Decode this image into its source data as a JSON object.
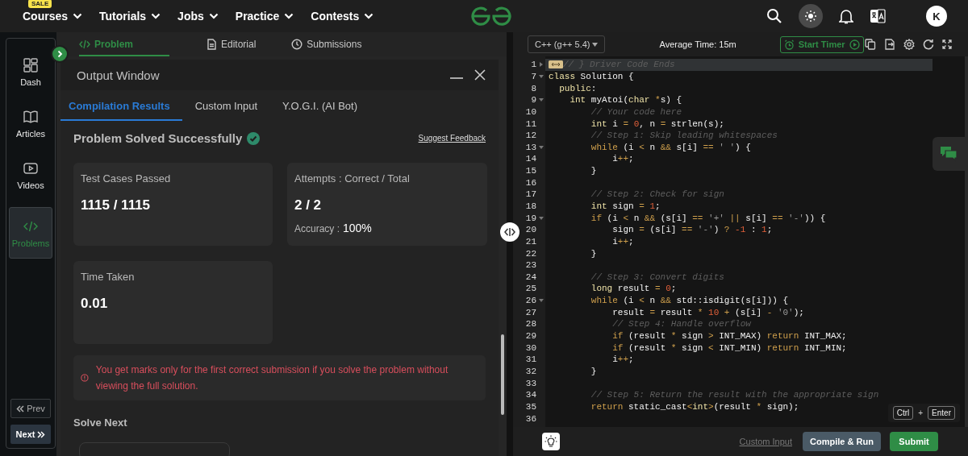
{
  "nav": {
    "items": [
      {
        "label": "Courses",
        "badge": "SALE"
      },
      {
        "label": "Tutorials"
      },
      {
        "label": "Jobs"
      },
      {
        "label": "Practice"
      },
      {
        "label": "Contests"
      }
    ],
    "avatar": "K"
  },
  "sidebar": {
    "items": [
      {
        "label": "Dash",
        "kind": "dash",
        "selected": false
      },
      {
        "label": "Articles",
        "kind": "articles",
        "selected": false
      },
      {
        "label": "Videos",
        "kind": "videos",
        "selected": false
      },
      {
        "label": "Problems",
        "kind": "problems",
        "selected": true
      }
    ],
    "prev": "Prev",
    "next": "Next"
  },
  "problem_tabs": [
    {
      "label": "Problem",
      "kind": "code",
      "selected": true
    },
    {
      "label": "Editorial",
      "kind": "doc",
      "selected": false
    },
    {
      "label": "Submissions",
      "kind": "clock",
      "selected": false
    }
  ],
  "output_window": {
    "title": "Output Window",
    "tabs": [
      {
        "label": "Compilation Results",
        "selected": true
      },
      {
        "label": "Custom Input",
        "selected": false
      },
      {
        "label": "Y.O.G.I. (AI Bot)",
        "selected": false
      }
    ],
    "status": "Problem Solved Successfully",
    "feedback_link": "Suggest Feedback",
    "cards": [
      {
        "label": "Test Cases Passed",
        "value": "1115 / 1115"
      },
      {
        "label": "Attempts : Correct / Total",
        "value": "2 / 2",
        "accuracy_label": "Accuracy :",
        "accuracy": "100%"
      },
      {
        "label": "Time Taken",
        "value": "0.01"
      }
    ],
    "warning": "You get marks only for the first correct submission if you solve the problem without viewing the full solution.",
    "solve_next": "Solve Next"
  },
  "editor": {
    "language": "C++ (g++ 5.4)",
    "average_time": "Average Time: 15m",
    "timer_button": "Start Timer",
    "lines": [
      {
        "n": "1",
        "foldable": true,
        "folded": true,
        "highlighted": true,
        "tokens": [
          {
            "kind": "comment",
            "text": "// } Driver Code Ends"
          }
        ]
      },
      {
        "n": "7",
        "foldable": true,
        "folded": false,
        "highlighted": false,
        "tokens": [
          {
            "kind": "type",
            "text": "class"
          },
          {
            "kind": "plain",
            "text": " Solution {"
          }
        ]
      },
      {
        "n": "8",
        "foldable": false,
        "folded": false,
        "highlighted": false,
        "tokens": [
          {
            "kind": "type",
            "text": "  public"
          },
          {
            "kind": "plain",
            "text": ":"
          }
        ]
      },
      {
        "n": "9",
        "foldable": true,
        "folded": false,
        "highlighted": false,
        "tokens": [
          {
            "kind": "type",
            "text": "    int"
          },
          {
            "kind": "plain",
            "text": " myAtoi("
          },
          {
            "kind": "type",
            "text": "char"
          },
          {
            "kind": "op",
            "text": " *"
          },
          {
            "kind": "plain",
            "text": "s) {"
          }
        ]
      },
      {
        "n": "10",
        "foldable": false,
        "folded": false,
        "highlighted": false,
        "tokens": [
          {
            "kind": "comment",
            "text": "        // Your code here"
          }
        ]
      },
      {
        "n": "11",
        "foldable": false,
        "folded": false,
        "highlighted": false,
        "tokens": [
          {
            "kind": "type",
            "text": "        int"
          },
          {
            "kind": "plain",
            "text": " i "
          },
          {
            "kind": "op",
            "text": "="
          },
          {
            "kind": "num",
            "text": " 0"
          },
          {
            "kind": "plain",
            "text": ", n "
          },
          {
            "kind": "op",
            "text": "="
          },
          {
            "kind": "plain",
            "text": " strlen(s);"
          }
        ]
      },
      {
        "n": "12",
        "foldable": false,
        "folded": false,
        "highlighted": false,
        "tokens": [
          {
            "kind": "comment",
            "text": "        // Step 1: Skip leading whitespaces"
          }
        ]
      },
      {
        "n": "13",
        "foldable": true,
        "folded": false,
        "highlighted": false,
        "tokens": [
          {
            "kind": "kw",
            "text": "        while"
          },
          {
            "kind": "plain",
            "text": " (i "
          },
          {
            "kind": "op",
            "text": "<"
          },
          {
            "kind": "plain",
            "text": " n "
          },
          {
            "kind": "op",
            "text": "&&"
          },
          {
            "kind": "plain",
            "text": " s[i] "
          },
          {
            "kind": "op",
            "text": "=="
          },
          {
            "kind": "str",
            "text": " ' '"
          },
          {
            "kind": "plain",
            "text": ") {"
          }
        ]
      },
      {
        "n": "14",
        "foldable": false,
        "folded": false,
        "highlighted": false,
        "tokens": [
          {
            "kind": "plain",
            "text": "            i"
          },
          {
            "kind": "op",
            "text": "++"
          },
          {
            "kind": "plain",
            "text": ";"
          }
        ]
      },
      {
        "n": "15",
        "foldable": false,
        "folded": false,
        "highlighted": false,
        "tokens": [
          {
            "kind": "plain",
            "text": "        }"
          }
        ]
      },
      {
        "n": "16",
        "foldable": false,
        "folded": false,
        "highlighted": false
      },
      {
        "n": "17",
        "foldable": false,
        "folded": false,
        "highlighted": false,
        "tokens": [
          {
            "kind": "comment",
            "text": "        // Step 2: Check for sign"
          }
        ]
      },
      {
        "n": "18",
        "foldable": false,
        "folded": false,
        "highlighted": false,
        "tokens": [
          {
            "kind": "type",
            "text": "        int"
          },
          {
            "kind": "plain",
            "text": " sign "
          },
          {
            "kind": "op",
            "text": "="
          },
          {
            "kind": "num",
            "text": " 1"
          },
          {
            "kind": "plain",
            "text": ";"
          }
        ]
      },
      {
        "n": "19",
        "foldable": true,
        "folded": false,
        "highlighted": false,
        "tokens": [
          {
            "kind": "kw",
            "text": "        if"
          },
          {
            "kind": "plain",
            "text": " (i "
          },
          {
            "kind": "op",
            "text": "<"
          },
          {
            "kind": "plain",
            "text": " n "
          },
          {
            "kind": "op",
            "text": "&&"
          },
          {
            "kind": "plain",
            "text": " (s[i] "
          },
          {
            "kind": "op",
            "text": "=="
          },
          {
            "kind": "str",
            "text": " '+'"
          },
          {
            "kind": "op",
            "text": " ||"
          },
          {
            "kind": "plain",
            "text": " s[i] "
          },
          {
            "kind": "op",
            "text": "=="
          },
          {
            "kind": "str",
            "text": " '-'"
          },
          {
            "kind": "plain",
            "text": ")) {"
          }
        ]
      },
      {
        "n": "20",
        "foldable": false,
        "folded": false,
        "highlighted": false,
        "tokens": [
          {
            "kind": "plain",
            "text": "            sign "
          },
          {
            "kind": "op",
            "text": "="
          },
          {
            "kind": "plain",
            "text": " (s[i] "
          },
          {
            "kind": "op",
            "text": "=="
          },
          {
            "kind": "str",
            "text": " '-'"
          },
          {
            "kind": "plain",
            "text": ") "
          },
          {
            "kind": "op",
            "text": "?"
          },
          {
            "kind": "num",
            "text": " -1"
          },
          {
            "kind": "plain",
            "text": " : "
          },
          {
            "kind": "num",
            "text": "1"
          },
          {
            "kind": "plain",
            "text": ";"
          }
        ]
      },
      {
        "n": "21",
        "foldable": false,
        "folded": false,
        "highlighted": false,
        "tokens": [
          {
            "kind": "plain",
            "text": "            i"
          },
          {
            "kind": "op",
            "text": "++"
          },
          {
            "kind": "plain",
            "text": ";"
          }
        ]
      },
      {
        "n": "22",
        "foldable": false,
        "folded": false,
        "highlighted": false,
        "tokens": [
          {
            "kind": "plain",
            "text": "        }"
          }
        ]
      },
      {
        "n": "23",
        "foldable": false,
        "folded": false,
        "highlighted": false
      },
      {
        "n": "24",
        "foldable": false,
        "folded": false,
        "highlighted": false,
        "tokens": [
          {
            "kind": "comment",
            "text": "        // Step 3: Convert digits"
          }
        ]
      },
      {
        "n": "25",
        "foldable": false,
        "folded": false,
        "highlighted": false,
        "tokens": [
          {
            "kind": "type",
            "text": "        long"
          },
          {
            "kind": "plain",
            "text": " result "
          },
          {
            "kind": "op",
            "text": "="
          },
          {
            "kind": "num",
            "text": " 0"
          },
          {
            "kind": "plain",
            "text": ";"
          }
        ]
      },
      {
        "n": "26",
        "foldable": true,
        "folded": false,
        "highlighted": false,
        "tokens": [
          {
            "kind": "kw",
            "text": "        while"
          },
          {
            "kind": "plain",
            "text": " (i "
          },
          {
            "kind": "op",
            "text": "<"
          },
          {
            "kind": "plain",
            "text": " n "
          },
          {
            "kind": "op",
            "text": "&&"
          },
          {
            "kind": "plain",
            "text": " std::isdigit(s[i])) {"
          }
        ]
      },
      {
        "n": "27",
        "foldable": false,
        "folded": false,
        "highlighted": false,
        "tokens": [
          {
            "kind": "plain",
            "text": "            result "
          },
          {
            "kind": "op",
            "text": "="
          },
          {
            "kind": "plain",
            "text": " result "
          },
          {
            "kind": "op",
            "text": "*"
          },
          {
            "kind": "num",
            "text": " 10"
          },
          {
            "kind": "op",
            "text": " +"
          },
          {
            "kind": "plain",
            "text": " (s[i] "
          },
          {
            "kind": "op",
            "text": "-"
          },
          {
            "kind": "str",
            "text": " '0'"
          },
          {
            "kind": "plain",
            "text": ");"
          }
        ]
      },
      {
        "n": "28",
        "foldable": false,
        "folded": false,
        "highlighted": false,
        "tokens": [
          {
            "kind": "comment",
            "text": "            // Step 4: Handle overflow"
          }
        ]
      },
      {
        "n": "29",
        "foldable": false,
        "folded": false,
        "highlighted": false,
        "tokens": [
          {
            "kind": "kw",
            "text": "            if"
          },
          {
            "kind": "plain",
            "text": " (result "
          },
          {
            "kind": "op",
            "text": "*"
          },
          {
            "kind": "plain",
            "text": " sign "
          },
          {
            "kind": "op",
            "text": ">"
          },
          {
            "kind": "plain",
            "text": " INT_MAX) "
          },
          {
            "kind": "kw",
            "text": "return"
          },
          {
            "kind": "plain",
            "text": " INT_MAX;"
          }
        ]
      },
      {
        "n": "30",
        "foldable": false,
        "folded": false,
        "highlighted": false,
        "tokens": [
          {
            "kind": "kw",
            "text": "            if"
          },
          {
            "kind": "plain",
            "text": " (result "
          },
          {
            "kind": "op",
            "text": "*"
          },
          {
            "kind": "plain",
            "text": " sign "
          },
          {
            "kind": "op",
            "text": "<"
          },
          {
            "kind": "plain",
            "text": " INT_MIN) "
          },
          {
            "kind": "kw",
            "text": "return"
          },
          {
            "kind": "plain",
            "text": " INT_MIN;"
          }
        ]
      },
      {
        "n": "31",
        "foldable": false,
        "folded": false,
        "highlighted": false,
        "tokens": [
          {
            "kind": "plain",
            "text": "            i"
          },
          {
            "kind": "op",
            "text": "++"
          },
          {
            "kind": "plain",
            "text": ";"
          }
        ]
      },
      {
        "n": "32",
        "foldable": false,
        "folded": false,
        "highlighted": false,
        "tokens": [
          {
            "kind": "plain",
            "text": "        }"
          }
        ]
      },
      {
        "n": "33",
        "foldable": false,
        "folded": false,
        "highlighted": false
      },
      {
        "n": "34",
        "foldable": false,
        "folded": false,
        "highlighted": false,
        "tokens": [
          {
            "kind": "comment",
            "text": "        // Step 5: Return the result with the appropriate sign"
          }
        ]
      },
      {
        "n": "35",
        "foldable": false,
        "folded": false,
        "highlighted": false,
        "tokens": [
          {
            "kind": "kw",
            "text": "        return"
          },
          {
            "kind": "plain",
            "text": " static_cast"
          },
          {
            "kind": "op",
            "text": "<"
          },
          {
            "kind": "type",
            "text": "int"
          },
          {
            "kind": "op",
            "text": ">"
          },
          {
            "kind": "plain",
            "text": "(result "
          },
          {
            "kind": "op",
            "text": "*"
          },
          {
            "kind": "plain",
            "text": " sign);"
          }
        ]
      },
      {
        "n": "36",
        "foldable": false,
        "folded": false,
        "highlighted": false
      }
    ],
    "shortcut": {
      "keys": [
        "Ctrl",
        "Enter"
      ],
      "joiner": "+"
    },
    "custom_input": "Custom Input",
    "compile_button": "Compile & Run",
    "submit_button": "Submit"
  }
}
